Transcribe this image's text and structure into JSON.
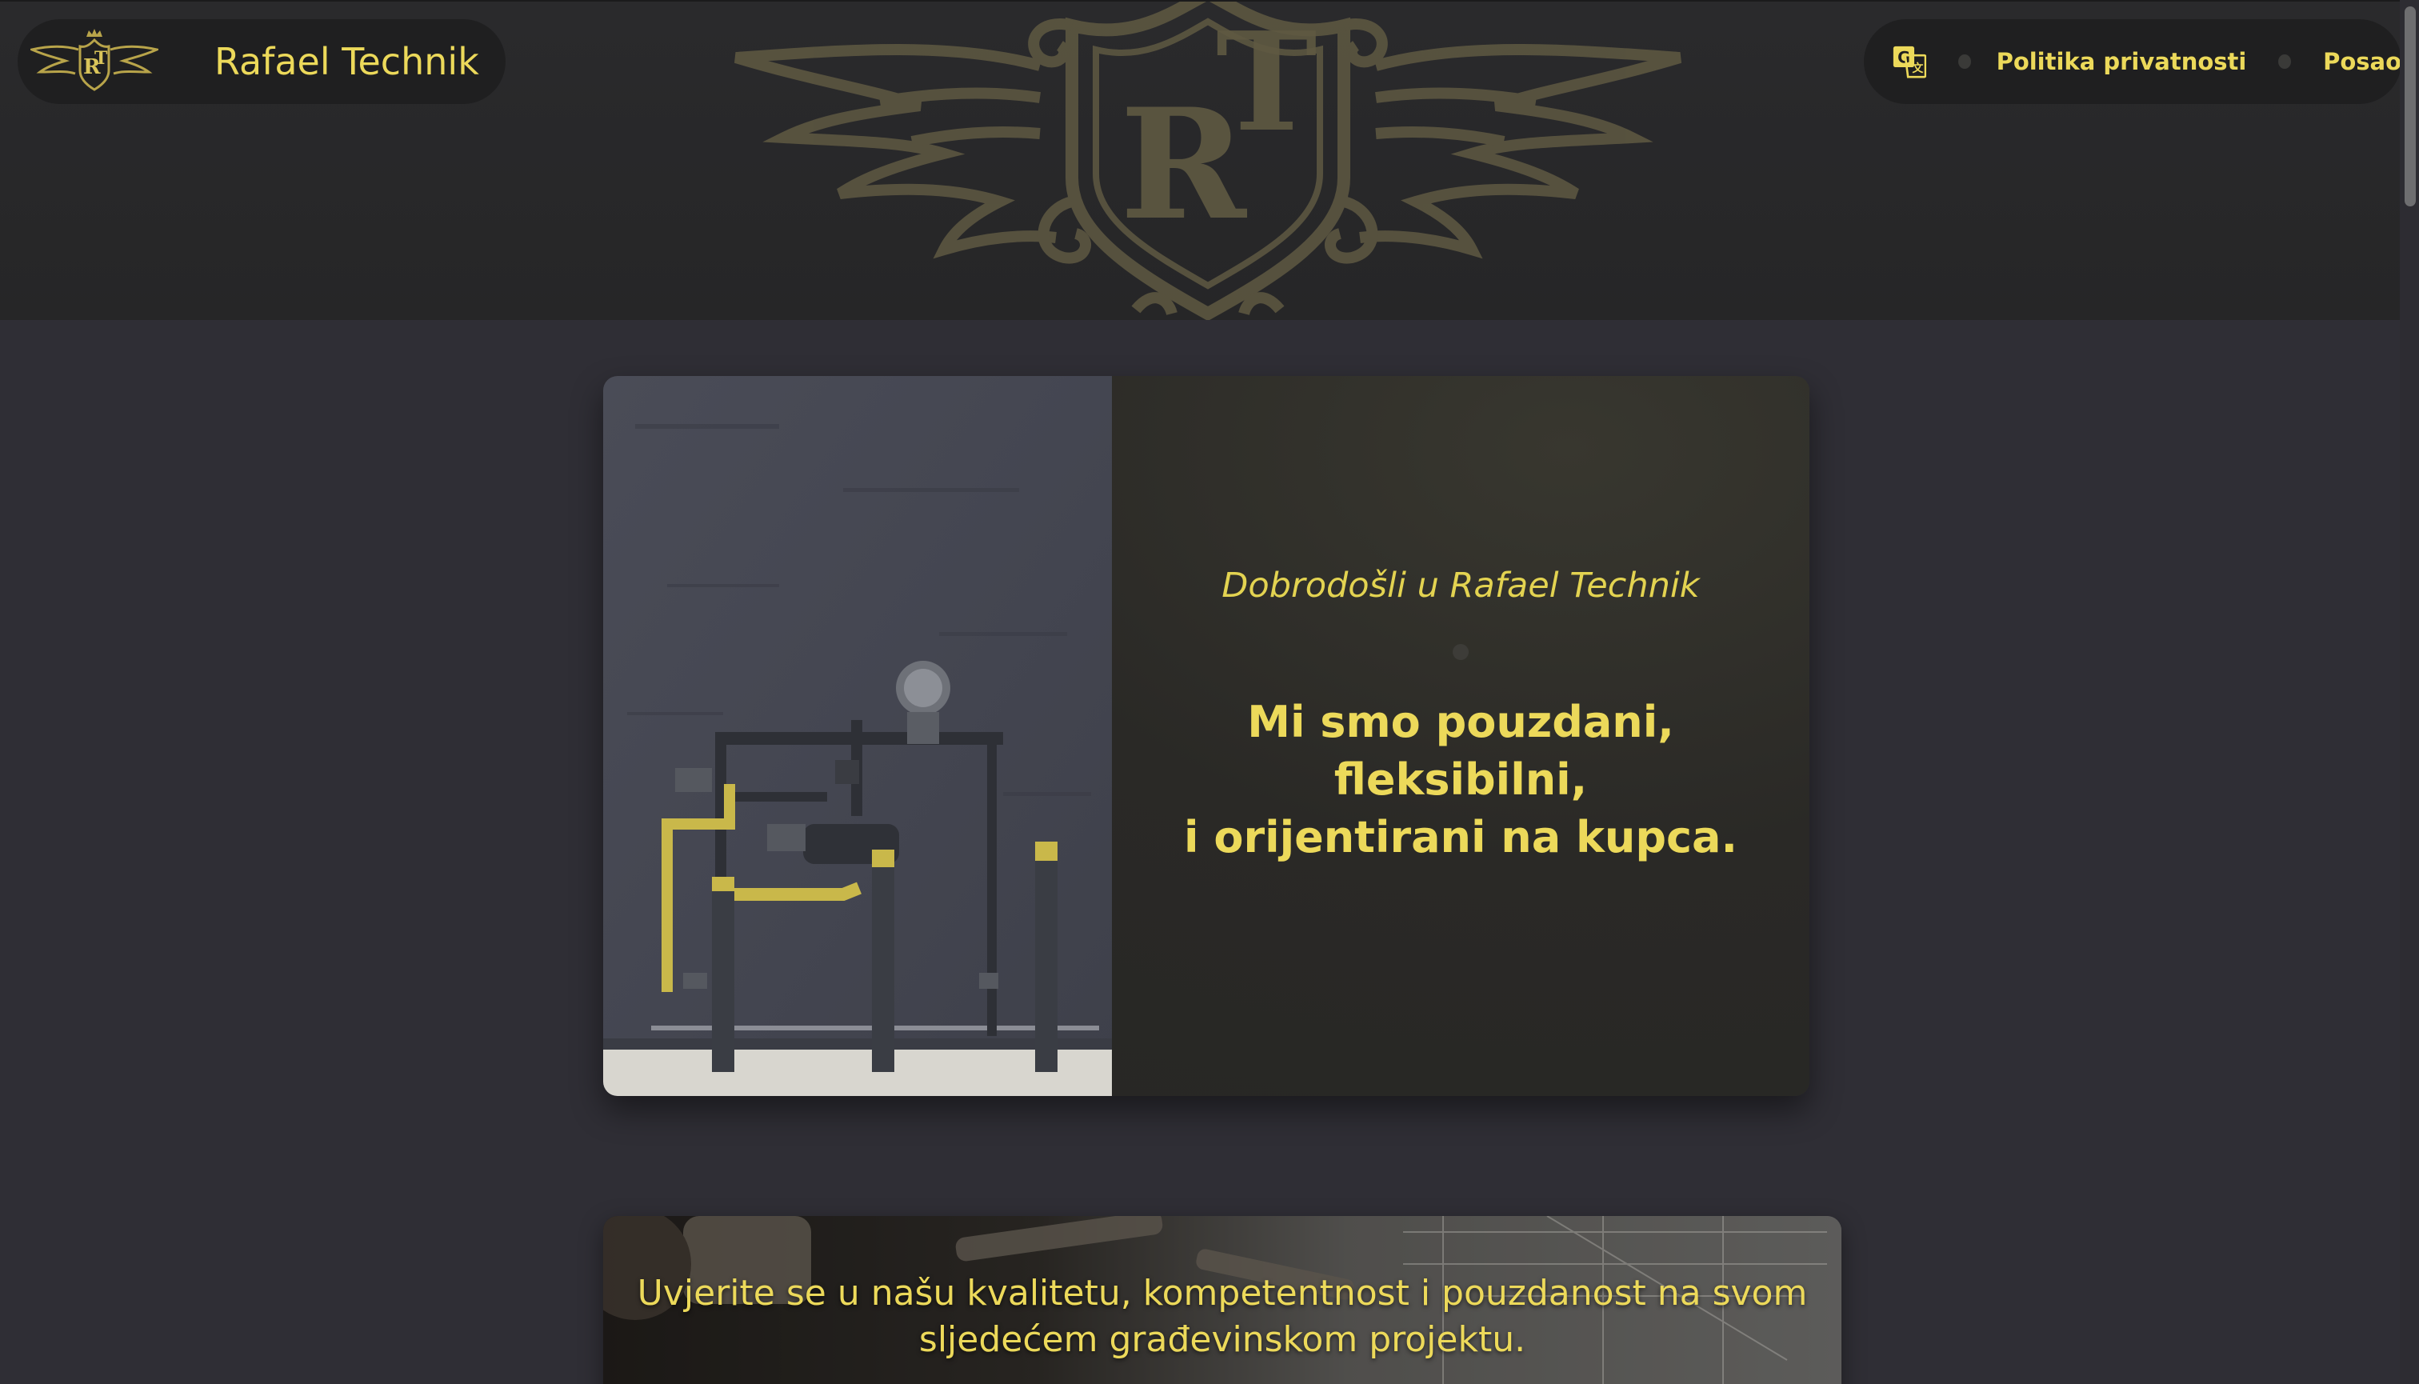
{
  "header": {
    "brand_name": "Rafael Technik",
    "logo_icon": "rt-winged-crest-logo",
    "emblem_icon": "rt-winged-shield-emblem",
    "logo_letters": "RT",
    "nav": {
      "translate_icon": "google-translate-icon",
      "links": [
        {
          "label": "Politika privatnosti"
        },
        {
          "label": "Posao"
        }
      ]
    }
  },
  "welcome": {
    "subtitle": "Dobrodošli u Rafael Technik",
    "heading_lines": [
      "Mi smo pouzdani,",
      "fleksibilni,",
      "i orijentirani na kupca."
    ],
    "image": "gas-pipes-wall-photo"
  },
  "quality": {
    "text_lines": [
      "Uvjerite se u našu kvalitetu, kompetentnost i pouzdanost na svom",
      "sljedećem građevinskom projektu."
    ],
    "image": "construction-plans-tools-photo"
  },
  "colors": {
    "accent": "#ecd95a",
    "page_bg": "#2f2e35",
    "header_bg": "#262627",
    "card_bg": "#2a2926",
    "emblem": "#6b6448"
  }
}
